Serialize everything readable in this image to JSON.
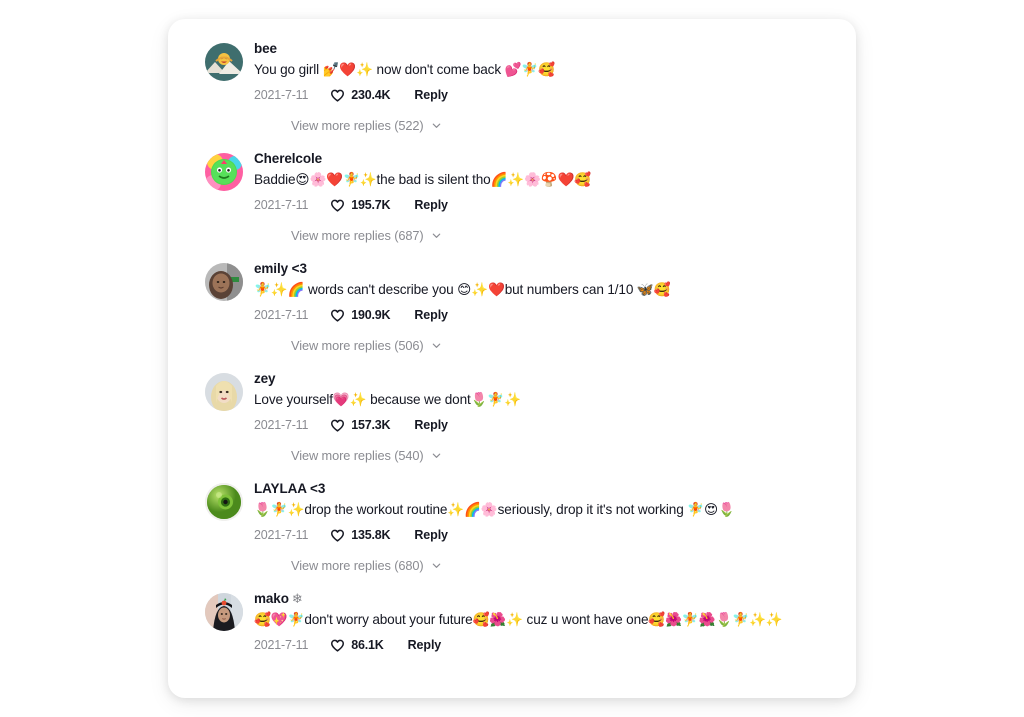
{
  "card": {
    "background": "#ffffff",
    "page_background": "#ffffff",
    "text_color": "#161823",
    "muted_color": "#8a8b91"
  },
  "comments": [
    {
      "username": "bee",
      "username_emoji": "",
      "text": "You go girll 💅❤️✨ now don't come back 💕🧚🥰",
      "date": "2021-7-11",
      "likes": "230.4K",
      "reply_label": "Reply",
      "view_more_label": "View more replies (522)",
      "avatar_name": "avatar-bee"
    },
    {
      "username": "Cherelcole",
      "username_emoji": "",
      "text": "Baddie😍🌸❤️🧚✨the bad is silent tho🌈✨🌸🍄❤️🥰",
      "date": "2021-7-11",
      "likes": "195.7K",
      "reply_label": "Reply",
      "view_more_label": "View more replies (687)",
      "avatar_name": "avatar-cherelcole"
    },
    {
      "username": "emily <3",
      "username_emoji": "",
      "text": "🧚✨🌈 words can't describe you 😊✨❤️but numbers can 1/10 🦋🥰",
      "date": "2021-7-11",
      "likes": "190.9K",
      "reply_label": "Reply",
      "view_more_label": "View more replies (506)",
      "avatar_name": "avatar-emily"
    },
    {
      "username": "zey",
      "username_emoji": "",
      "text": "Love yourself💗✨ because we dont🌷🧚✨",
      "date": "2021-7-11",
      "likes": "157.3K",
      "reply_label": "Reply",
      "view_more_label": "View more replies (540)",
      "avatar_name": "avatar-zey"
    },
    {
      "username": "LAYLAA <3",
      "username_emoji": "",
      "text": "🌷🧚✨drop the workout routine✨🌈🌸seriously, drop it it's not working 🧚😍🌷",
      "date": "2021-7-11",
      "likes": "135.8K",
      "reply_label": "Reply",
      "view_more_label": "View more replies (680)",
      "avatar_name": "avatar-laylaa"
    },
    {
      "username": "mako",
      "username_emoji": "❄",
      "text": "🥰💖🧚don't worry about your future🥰🌺✨ cuz u wont have one🥰🌺🧚🌺🌷🧚✨✨",
      "date": "2021-7-11",
      "likes": "86.1K",
      "reply_label": "Reply",
      "view_more_label": "",
      "avatar_name": "avatar-mako"
    }
  ],
  "icons": {
    "heart": "heart-outline-icon",
    "chevron": "chevron-down-icon"
  }
}
